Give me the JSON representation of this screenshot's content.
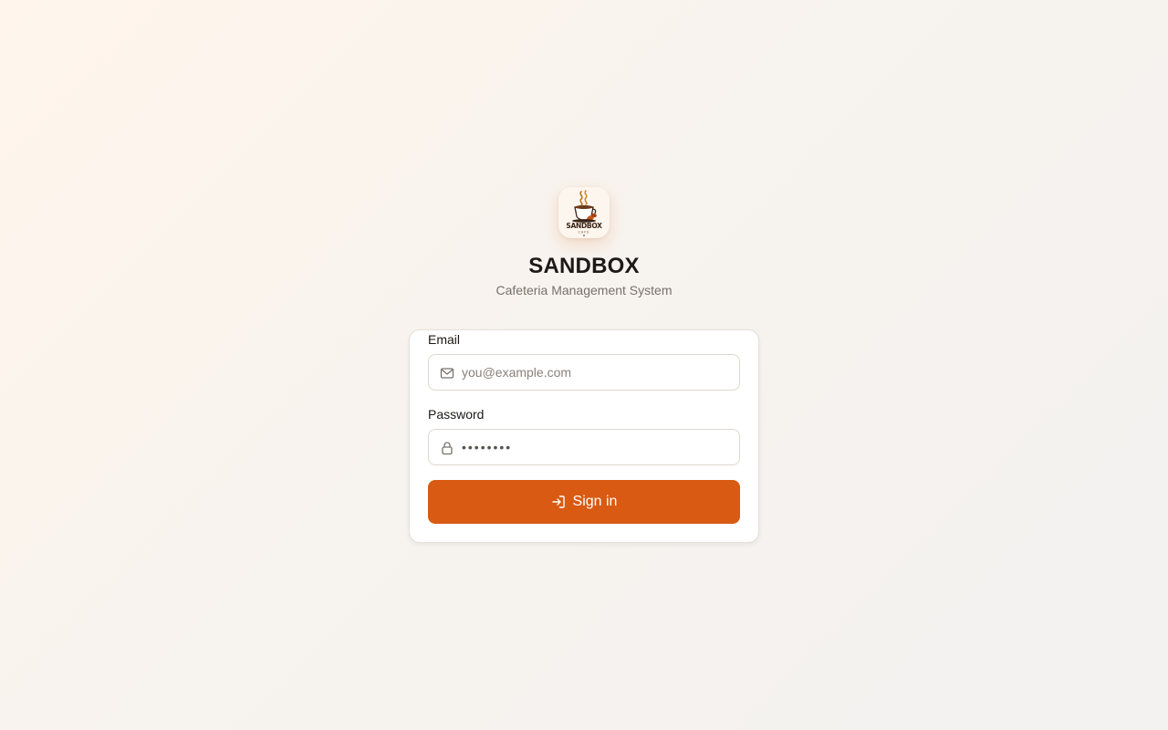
{
  "app": {
    "title": "SANDBOX",
    "subtitle": "Cafeteria Management System",
    "logo": {
      "icon": "coffee-cup-logo",
      "lettering": "SANDBOX CAFE"
    }
  },
  "form": {
    "email": {
      "label": "Email",
      "placeholder": "you@example.com",
      "value": "",
      "icon": "mail-icon"
    },
    "password": {
      "label": "Password",
      "value": "password",
      "icon": "lock-icon"
    },
    "submit": {
      "label": "Sign in",
      "icon": "log-in-icon"
    }
  },
  "colors": {
    "accent": "#d95a12",
    "background_start": "#fff5ec",
    "background_end": "#f3f2f0",
    "text_primary": "#1c1917",
    "text_muted": "#78716c",
    "border": "#dcd7d2"
  }
}
